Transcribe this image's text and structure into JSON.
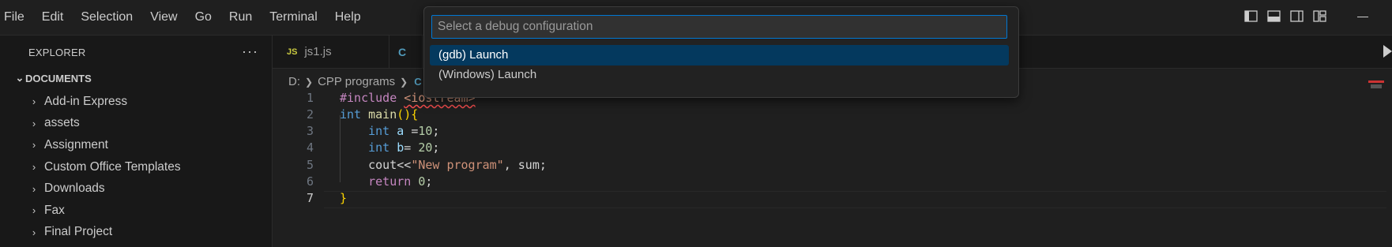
{
  "menubar": {
    "items": [
      "File",
      "Edit",
      "Selection",
      "View",
      "Go",
      "Run",
      "Terminal",
      "Help"
    ]
  },
  "sidebar": {
    "title": "EXPLORER",
    "section": "DOCUMENTS",
    "items": [
      "Add-in Express",
      "assets",
      "Assignment",
      "Custom Office Templates",
      "Downloads",
      "Fax",
      "Final Project"
    ]
  },
  "tabs": [
    {
      "label": "js1.js",
      "icon": "JS"
    },
    {
      "label": "",
      "icon": "C"
    }
  ],
  "breadcrumb": [
    "D:",
    "CPP programs",
    "C"
  ],
  "editor": {
    "line_numbers": [
      "1",
      "2",
      "3",
      "4",
      "5",
      "6",
      "7"
    ],
    "active_line": 7
  },
  "quick_pick": {
    "placeholder": "Select a debug configuration",
    "options": [
      "(gdb) Launch",
      "(Windows) Launch"
    ],
    "selected_index": 0
  },
  "colors": {
    "accent": "#0078d4",
    "selection": "#04395e",
    "background": "#1f1f1f"
  }
}
